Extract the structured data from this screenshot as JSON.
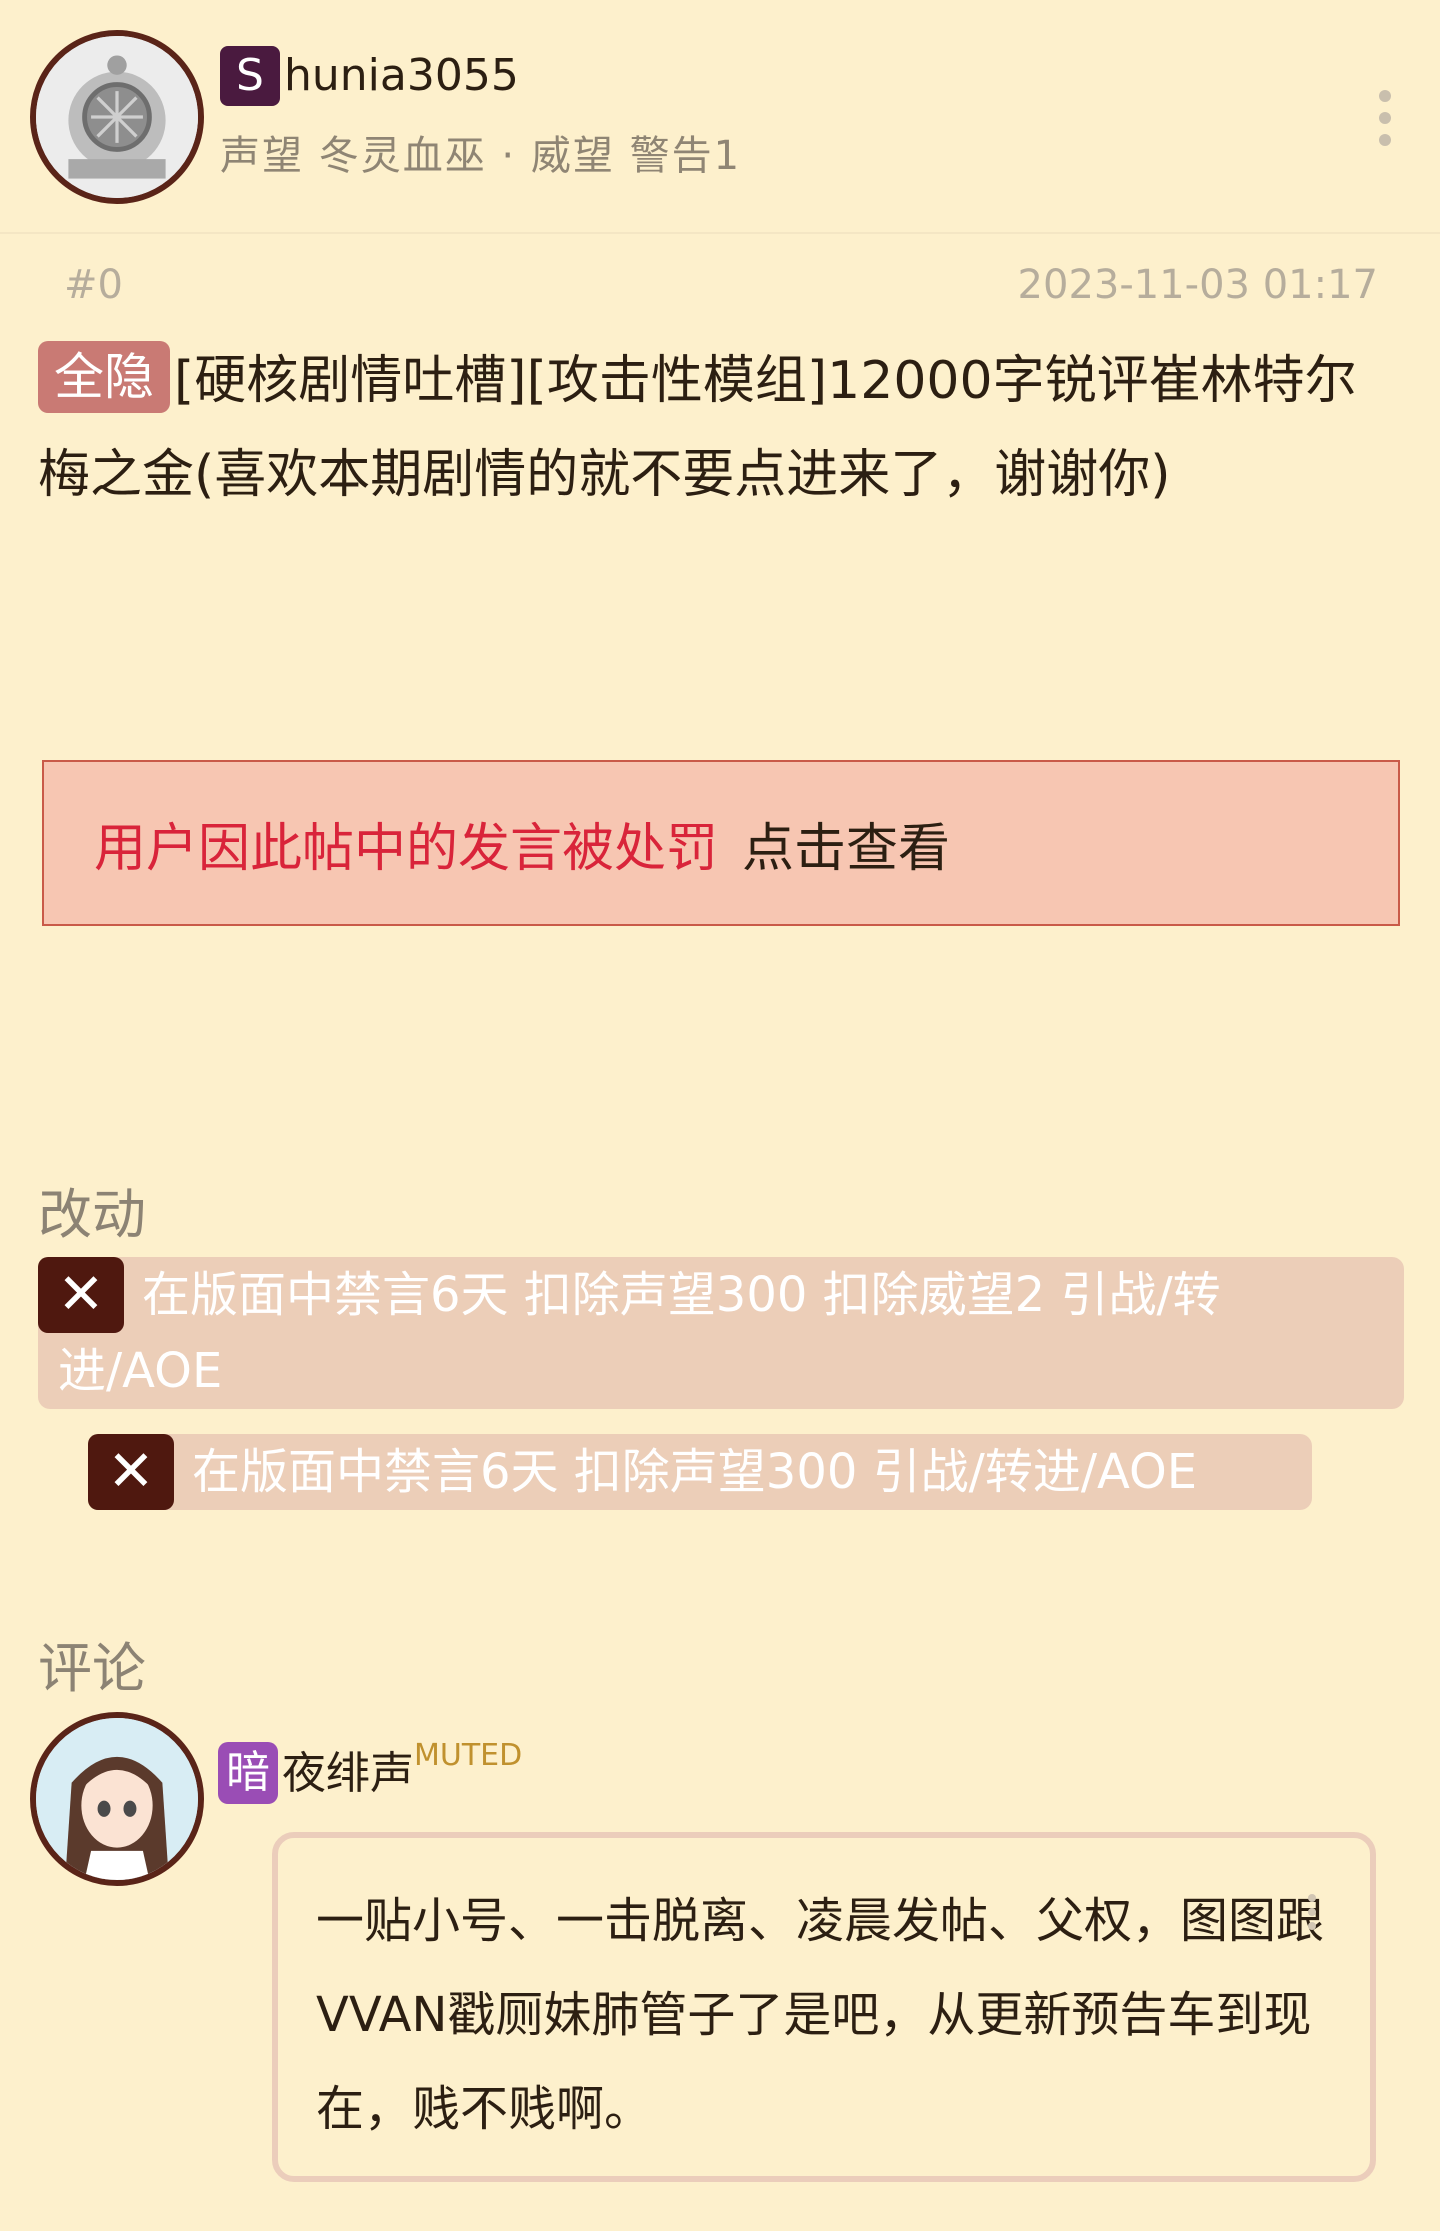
{
  "header": {
    "user_badge": "S",
    "username": "hunia3055",
    "meta": "声望 冬灵血巫 · 威望 警告1"
  },
  "post": {
    "number": "#0",
    "time": "2023-11-03 01:17",
    "tag": "全隐",
    "title": "[硬核剧情吐槽][攻击性模组]12000字锐评崔林特尔梅之金(喜欢本期剧情的就不要点进来了，谢谢你)"
  },
  "penalty": {
    "message": "用户因此帖中的发言被处罚",
    "link": "点击查看"
  },
  "moderation": {
    "label": "改动",
    "entries": [
      {
        "icon": "✕",
        "text_line1": "在版面中禁言6天 扣除声望300 扣除威望2 引战/转",
        "text_line2": "进/AOE"
      },
      {
        "icon": "✕",
        "text": "在版面中禁言6天 扣除声望300 引战/转进/AOE"
      }
    ]
  },
  "comments": {
    "label": "评论",
    "items": [
      {
        "badge": "暗",
        "name": "夜绯声",
        "status": "MUTED",
        "text": "一贴小号、一击脱离、凌晨发帖、父权，图图跟VVAN戳厕妹肺管子了是吧，从更新预告车到现在，贱不贱啊。"
      }
    ]
  },
  "colors": {
    "background": "#fdf0cc",
    "penalty_bg": "#f7c6b2",
    "penalty_text": "#d9243a",
    "tag_hidden": "#c97a74",
    "mod_bg": "#ecceb8",
    "mod_icon": "#4f180f",
    "user_badge": "#4a1a3f",
    "comment_badge": "#9a4db5",
    "muted": "#c0912e"
  }
}
